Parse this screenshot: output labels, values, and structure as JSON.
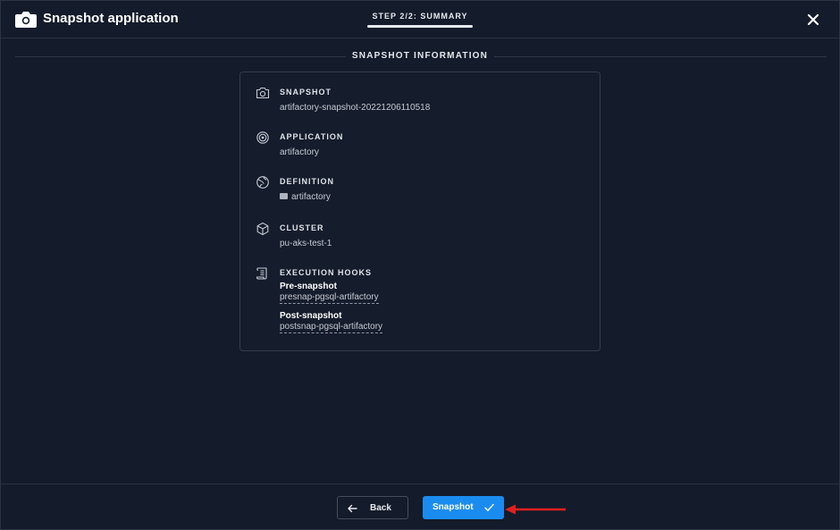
{
  "header": {
    "title": "Snapshot application",
    "step": "STEP 2/2: SUMMARY"
  },
  "section": {
    "title": "SNAPSHOT INFORMATION"
  },
  "info": {
    "snapshot": {
      "label": "SNAPSHOT",
      "value": "artifactory-snapshot-20221206110518"
    },
    "application": {
      "label": "APPLICATION",
      "value": "artifactory"
    },
    "definition": {
      "label": "DEFINITION",
      "value": "artifactory"
    },
    "cluster": {
      "label": "CLUSTER",
      "value": "pu-aks-test-1"
    },
    "hooks": {
      "label": "EXECUTION HOOKS",
      "pre_label": "Pre-snapshot",
      "pre_value": "presnap-pgsql-artifactory",
      "post_label": "Post-snapshot",
      "post_value": "postsnap-pgsql-artifactory"
    }
  },
  "footer": {
    "back_label": "Back",
    "snapshot_label": "Snapshot"
  },
  "icons": {
    "header": "camera-icon",
    "close": "close-icon",
    "snapshot": "camera-icon",
    "application": "target-icon",
    "definition": "globe-icon",
    "cluster": "cube-icon",
    "hooks": "scroll-icon",
    "folder": "folder-icon",
    "back": "arrow-left-icon",
    "confirm": "check-icon"
  },
  "colors": {
    "background": "#141b2a",
    "primary_button": "#1a8cf0",
    "annotation_arrow": "#e02020"
  }
}
